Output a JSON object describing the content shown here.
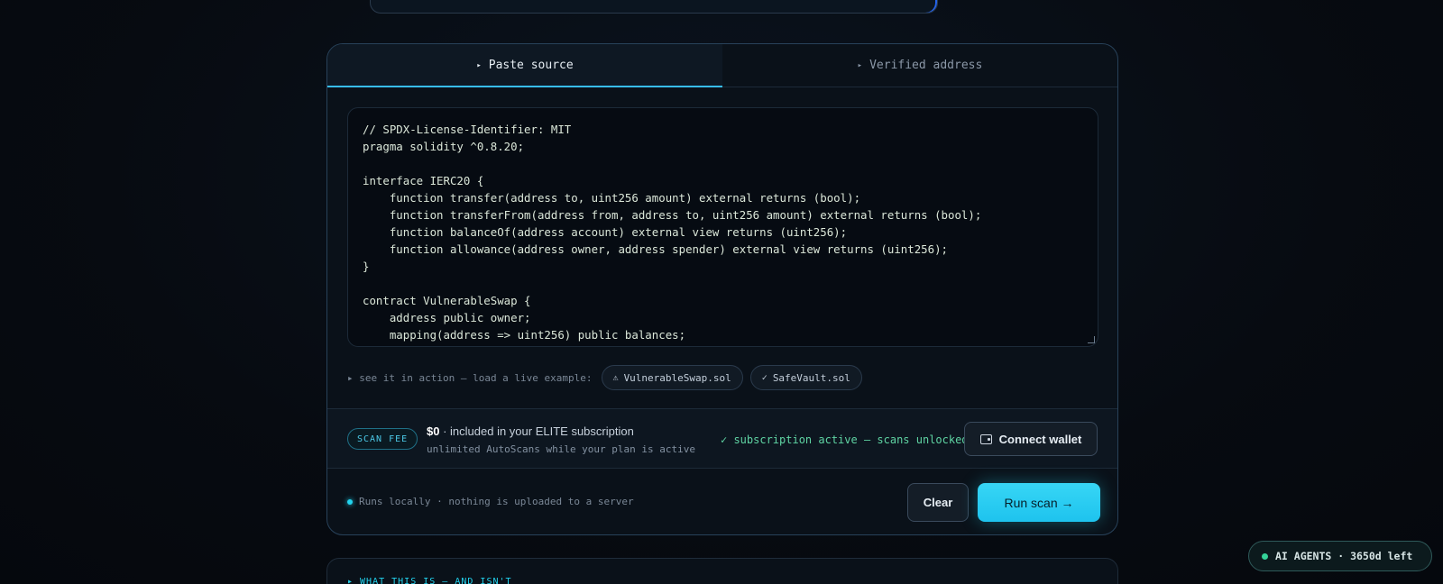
{
  "tabs": [
    {
      "label": "Paste source",
      "active": true
    },
    {
      "label": "Verified address",
      "active": false
    }
  ],
  "editor": {
    "code": "// SPDX-License-Identifier: MIT\npragma solidity ^0.8.20;\n\ninterface IERC20 {\n    function transfer(address to, uint256 amount) external returns (bool);\n    function transferFrom(address from, address to, uint256 amount) external returns (bool);\n    function balanceOf(address account) external view returns (uint256);\n    function allowance(address owner, address spender) external view returns (uint256);\n}\n\ncontract VulnerableSwap {\n    address public owner;\n    mapping(address => uint256) public balances;"
  },
  "examples": {
    "label": "▸ see it in action — load a live example:",
    "chips": [
      {
        "glyph": "⚠",
        "label": "VulnerableSwap.sol"
      },
      {
        "glyph": "✓",
        "label": "SafeVault.sol"
      }
    ]
  },
  "fee": {
    "badge": "SCAN FEE",
    "price": "$0",
    "included": "· included in your ELITE subscription",
    "sub": "unlimited AutoScans while your plan is active",
    "status": "✓ subscription active — scans unlocked",
    "wallet_button": "Connect wallet"
  },
  "footer": {
    "local_note": "Runs locally · nothing is uploaded to a server",
    "clear_button": "Clear",
    "run_button": "Run scan →"
  },
  "what_section": {
    "title": "▸ WHAT THIS IS — AND ISN'T"
  },
  "agents_badge": "AI AGENTS · 3650d left",
  "colors": {
    "accent": "#22d3ee",
    "success": "#5fd4a3"
  }
}
